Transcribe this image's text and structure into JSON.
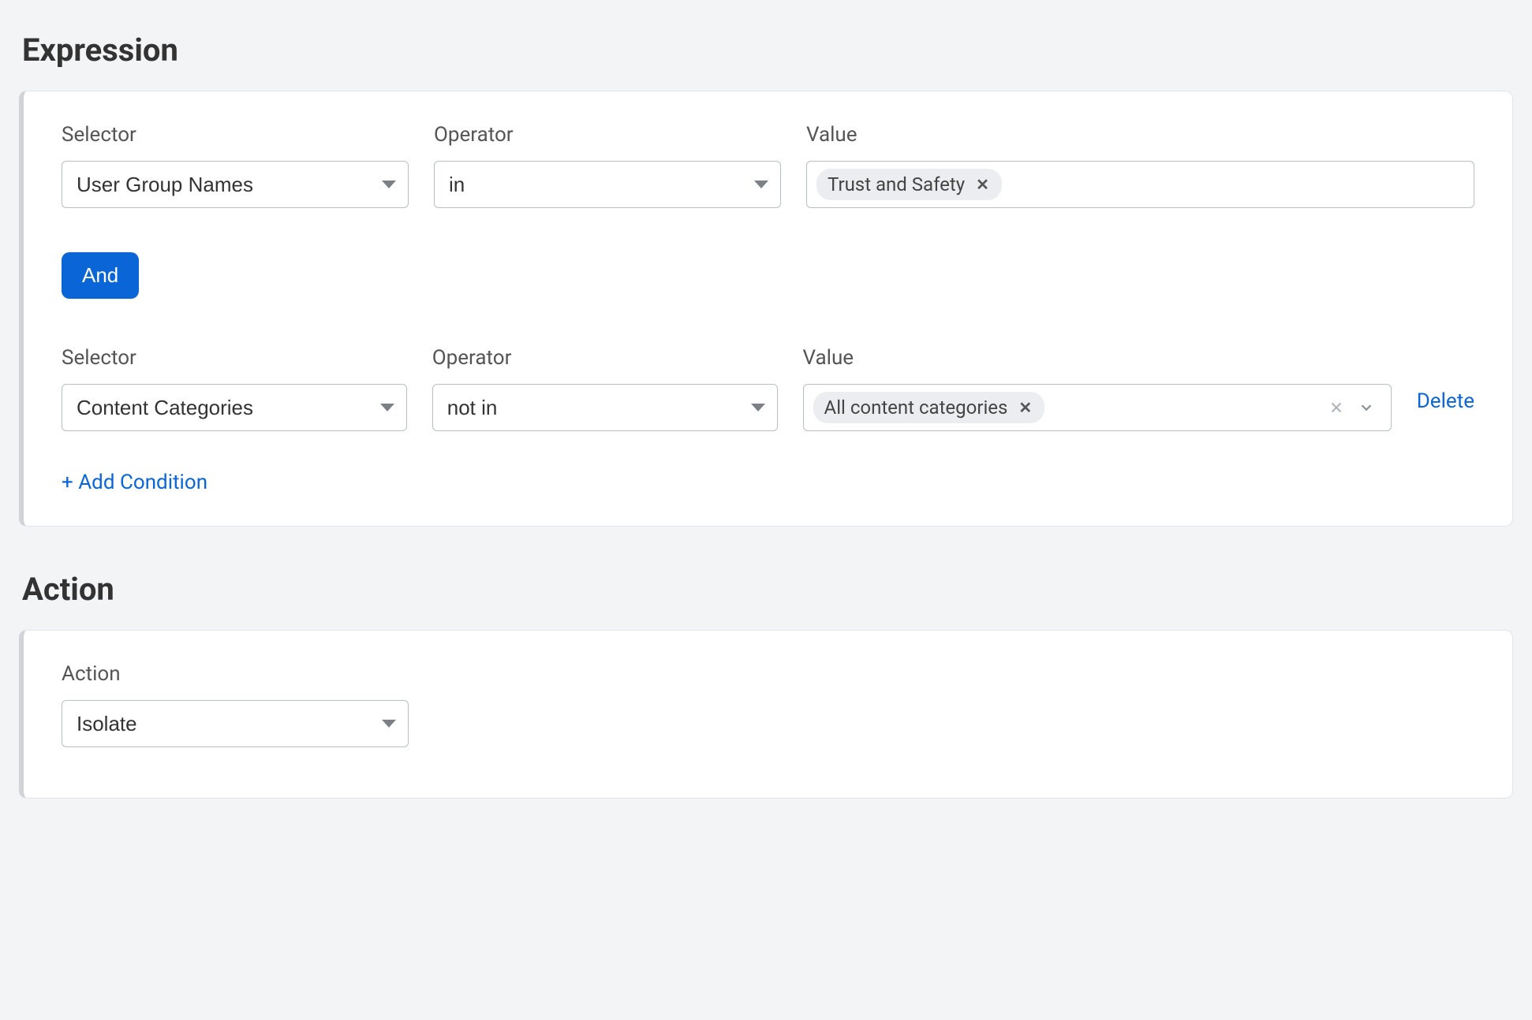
{
  "expression": {
    "title": "Expression",
    "labels": {
      "selector": "Selector",
      "operator": "Operator",
      "value": "Value"
    },
    "and_label": "And",
    "row1": {
      "selector": "User Group Names",
      "operator": "in",
      "value_tag": "Trust and Safety"
    },
    "row2": {
      "selector": "Content Categories",
      "operator": "not in",
      "value_tag": "All content categories",
      "delete_label": "Delete"
    },
    "add_condition_label": "+ Add Condition"
  },
  "action": {
    "title": "Action",
    "label": "Action",
    "value": "Isolate"
  }
}
